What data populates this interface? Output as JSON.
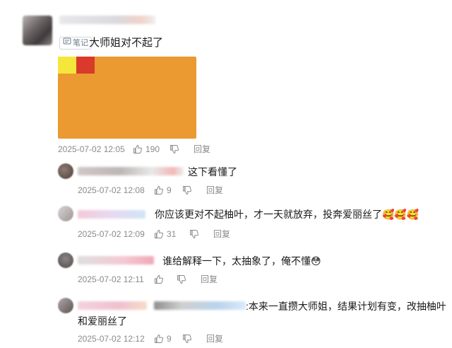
{
  "main_comment": {
    "tag_label": "笔记",
    "text": "大师姐对不起了",
    "timestamp": "2025-07-02 12:05",
    "likes": "190",
    "reply_label": "回复"
  },
  "replies": [
    {
      "text": "这下看懂了",
      "timestamp": "2025-07-02 12:08",
      "likes": "9",
      "reply_label": "回复"
    },
    {
      "text": "你应该更对不起柚叶，才一天就放弃，投奔爱丽丝了",
      "emoji": "🥰🥰🥰",
      "timestamp": "2025-07-02 12:09",
      "likes": "31",
      "reply_label": "回复"
    },
    {
      "text": "谁给解释一下，太抽象了，俺不懂",
      "emoji": "😳",
      "timestamp": "2025-07-02 12:11",
      "likes": "",
      "reply_label": "回复"
    },
    {
      "text_line1": ":本来一直攒大师姐，结果计划有变，改抽柚叶",
      "text_line2": "和爱丽丝了",
      "timestamp": "2025-07-02 12:12",
      "likes": "9",
      "reply_label": "回复"
    }
  ],
  "colors": {
    "image_bg": "#ea9a30",
    "image_swatch_yellow": "#f5e63c",
    "image_swatch_red": "#d93a2a"
  },
  "icons": [
    "note-icon",
    "like-icon",
    "dislike-icon"
  ]
}
